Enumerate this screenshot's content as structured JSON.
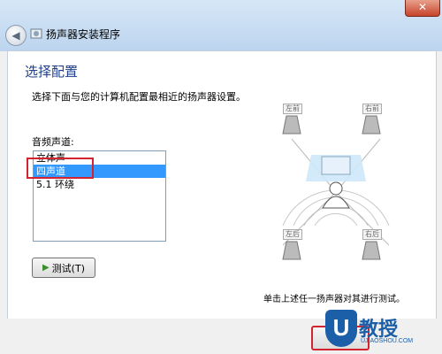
{
  "window": {
    "title": "扬声器安装程序",
    "close_label": "✕",
    "back_label": "◀"
  },
  "content": {
    "heading": "选择配置",
    "description": "选择下面与您的计算机配置最相近的扬声器设置。",
    "list_label": "音频声道:",
    "options": [
      "立体声",
      "四声道",
      "5.1 环绕"
    ],
    "selected_option": "四声道",
    "test_button": "测试(T)",
    "hint": "单击上述任一扬声器对其进行测试。"
  },
  "speakers": {
    "front_left": "左前",
    "front_right": "右前",
    "rear_left": "左后",
    "rear_right": "右后"
  },
  "watermark": {
    "logo_letter": "U",
    "brand": "教授",
    "url": "UJIAOSHOU.COM"
  },
  "colors": {
    "heading": "#1e3f8a",
    "selection": "#3399ff",
    "highlight": "#d3232e",
    "brand": "#1a5fa8"
  }
}
